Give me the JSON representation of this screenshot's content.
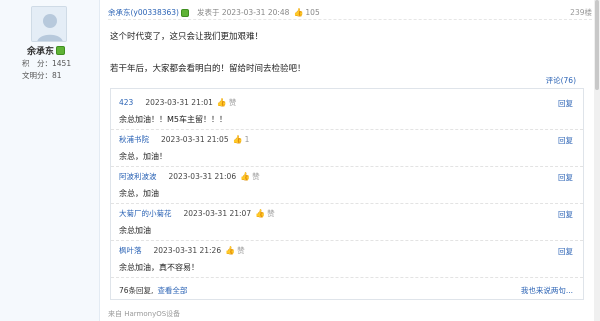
{
  "user": {
    "name": "余承东",
    "stats": [
      {
        "label": "积　分",
        "value": "1451"
      },
      {
        "label": "文明分",
        "value": "81"
      }
    ]
  },
  "post": {
    "author": "余承东(y00338363)",
    "time": "发表于 2023-03-31 20:48",
    "likes": "105",
    "floor": "239楼",
    "lines": [
      "这个时代变了，这只会让我们更加艰难！",
      "若干年后，大家都会看明白的！留给时间去检验吧！"
    ],
    "comment_link": "评论(76)"
  },
  "replies": [
    {
      "user": "423",
      "time": "2023-03-31 21:01",
      "like_label": "赞",
      "text": "余总加油！！M5车主留！！！",
      "reply_label": "回复"
    },
    {
      "user": "秋浦书院",
      "time": "2023-03-31 21:05",
      "like_label": "1",
      "text": "余总，加油！",
      "reply_label": "回复"
    },
    {
      "user": "阿波利波波",
      "time": "2023-03-31 21:06",
      "like_label": "赞",
      "text": "余总，加油",
      "reply_label": "回复"
    },
    {
      "user": "大菊厂的小菊花",
      "time": "2023-03-31 21:07",
      "like_label": "赞",
      "text": "余总加油",
      "reply_label": "回复"
    },
    {
      "user": "枫叶落",
      "time": "2023-03-31 21:26",
      "like_label": "赞",
      "text": "余总加油，真不容易！",
      "reply_label": "回复"
    }
  ],
  "reply_footer": {
    "count": "76条回复,",
    "view_all": "查看全部",
    "say": "我也来说两句..."
  },
  "source": "来自 HarmonyOS设备",
  "colors": {
    "link": "#2b63b5",
    "badge": "#5fb336",
    "sidebar_bg": "#f5f9fd"
  }
}
